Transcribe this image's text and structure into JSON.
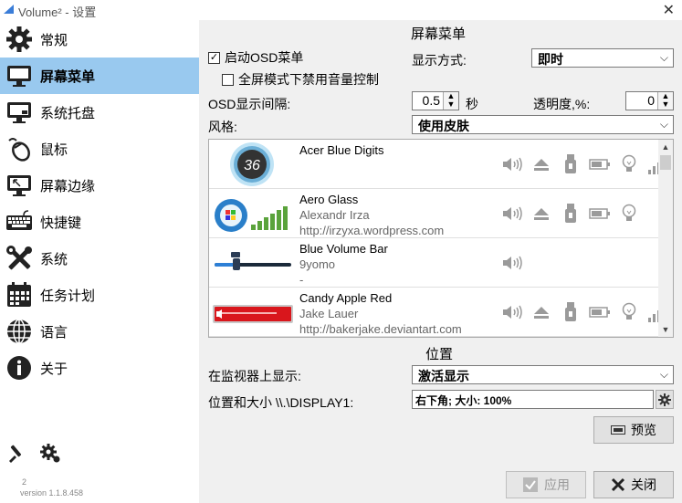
{
  "window": {
    "title": "Volume² - 设置",
    "close_glyph": "✕"
  },
  "sidebar": {
    "items": [
      {
        "label": "常规",
        "icon": "gear-icon"
      },
      {
        "label": "屏幕菜单",
        "icon": "monitor-icon"
      },
      {
        "label": "系统托盘",
        "icon": "tray-icon"
      },
      {
        "label": "鼠标",
        "icon": "mouse-icon"
      },
      {
        "label": "屏幕边缘",
        "icon": "screen-edge-icon"
      },
      {
        "label": "快捷键",
        "icon": "keyboard-icon"
      },
      {
        "label": "系统",
        "icon": "tools-icon"
      },
      {
        "label": "任务计划",
        "icon": "calendar-icon"
      },
      {
        "label": "语言",
        "icon": "globe-icon"
      },
      {
        "label": "关于",
        "icon": "info-icon"
      }
    ],
    "selected_index": 1,
    "version_sup": "2",
    "version": "version 1.1.8.458"
  },
  "osd": {
    "section_title": "屏幕菜单",
    "enable_label": "启动OSD菜单",
    "enable_checked": true,
    "fullscreen_label": "全屏模式下禁用音量控制",
    "fullscreen_checked": false,
    "display_mode_label": "显示方式:",
    "display_mode_value": "即时",
    "interval_label": "OSD显示间隔:",
    "interval_value": "0.5",
    "interval_unit": "秒",
    "transparency_label": "透明度,%:",
    "transparency_value": "0",
    "style_label": "风格:",
    "style_value": "使用皮肤"
  },
  "skins": [
    {
      "name": "Acer Blue Digits",
      "author": "",
      "url": "",
      "thumb_text": "36"
    },
    {
      "name": "Aero Glass",
      "author": "Alexandr Irza",
      "url": "http://irzyxa.wordpress.com",
      "thumb_text": ""
    },
    {
      "name": "Blue Volume Bar",
      "author": "9yomo",
      "url": "-",
      "thumb_text": ""
    },
    {
      "name": "Candy Apple Red",
      "author": "Jake Lauer",
      "url": "http://bakerjake.deviantart.com",
      "thumb_text": ""
    }
  ],
  "feature_icons": [
    "speaker-icon",
    "eject-icon",
    "usb-icon",
    "battery-icon",
    "bulb-icon",
    "signal-bars-icon"
  ],
  "position": {
    "section_title": "位置",
    "monitor_label": "在监视器上显示:",
    "monitor_value": "激活显示",
    "pos_label": "位置和大小 \\\\.\\DISPLAY1:",
    "pos_value": "右下角; 大小: 100%",
    "preview_label": "预览"
  },
  "footer": {
    "apply_label": "应用",
    "close_label": "关闭"
  },
  "colors": {
    "selected_bg": "#99c9ef",
    "panel_bg": "#f0f0f0"
  }
}
